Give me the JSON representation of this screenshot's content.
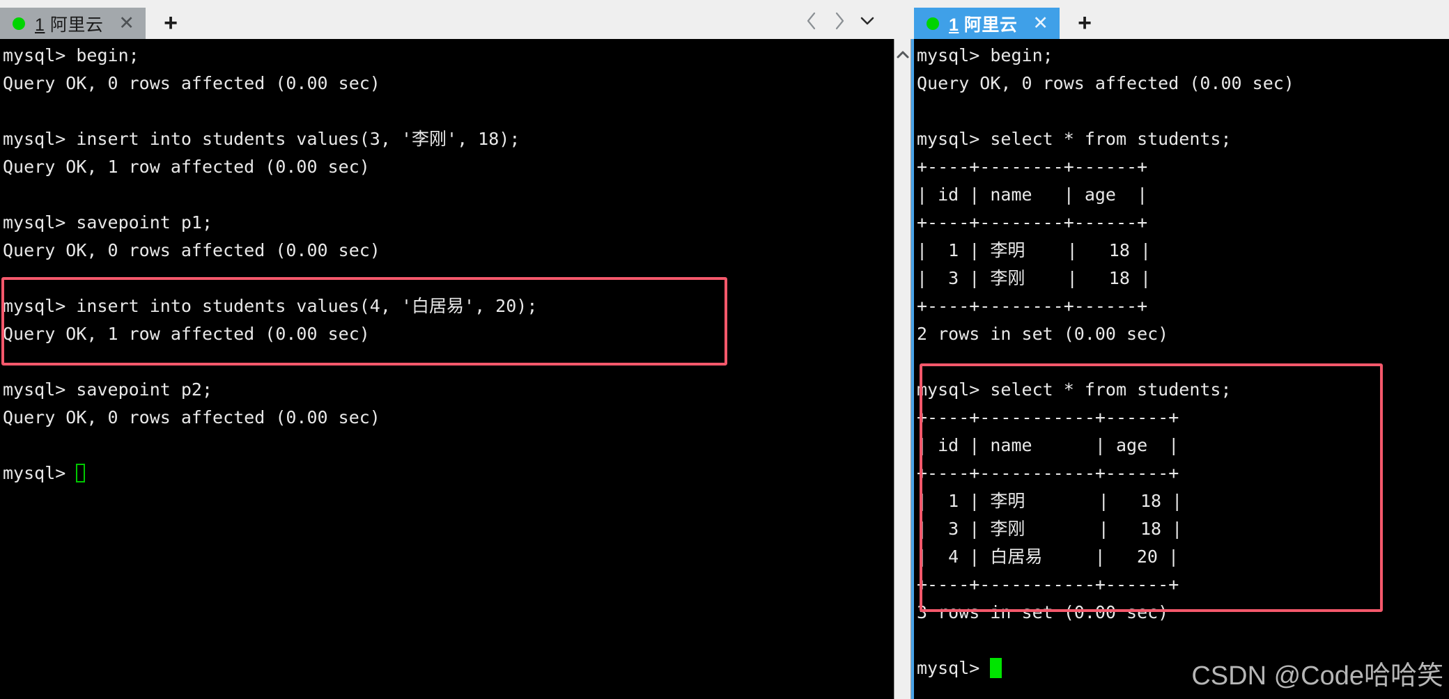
{
  "window": {
    "left_tab": {
      "number": "1",
      "title": "阿里云",
      "close": "✕",
      "add": "+",
      "state": "inactive"
    },
    "right_tab": {
      "number": "1",
      "title": "阿里云",
      "close": "✕",
      "add": "+",
      "state": "active"
    },
    "nav": {
      "prev": "back-chevron",
      "next": "forward-chevron",
      "list": "dropdown-chevron"
    }
  },
  "left_pane": {
    "prompt": "mysql>",
    "lines": [
      "mysql> begin;",
      "Query OK, 0 rows affected (0.00 sec)",
      "",
      "mysql> insert into students values(3, '李刚', 18);",
      "Query OK, 1 row affected (0.00 sec)",
      "",
      "mysql> savepoint p1;",
      "Query OK, 0 rows affected (0.00 sec)",
      "",
      "mysql> insert into students values(4, '白居易', 20);",
      "Query OK, 1 row affected (0.00 sec)",
      "",
      "mysql> savepoint p2;",
      "Query OK, 0 rows affected (0.00 sec)",
      "",
      "mysql> "
    ],
    "cursor": "hollow-green-block",
    "scrollbar": {
      "arrow": "up-chevron"
    }
  },
  "right_pane": {
    "prompt": "mysql>",
    "lines": [
      "mysql> begin;",
      "Query OK, 0 rows affected (0.00 sec)",
      "",
      "mysql> select * from students;",
      "+----+--------+------+",
      "| id | name   | age  |",
      "+----+--------+------+",
      "|  1 | 李明    |   18 |",
      "|  3 | 李刚    |   18 |",
      "+----+--------+------+",
      "2 rows in set (0.00 sec)",
      "",
      "mysql> select * from students;",
      "+----+-----------+------+",
      "| id | name      | age  |",
      "+----+-----------+------+",
      "|  1 | 李明       |   18 |",
      "|  3 | 李刚       |   18 |",
      "|  4 | 白居易     |   20 |",
      "+----+-----------+------+",
      "3 rows in set (0.00 sec)",
      "",
      "mysql> "
    ],
    "cursor": "solid-green-block",
    "tables": [
      {
        "query": "select * from students;",
        "columns": [
          "id",
          "name",
          "age"
        ],
        "rows": [
          [
            "1",
            "李明",
            "18"
          ],
          [
            "3",
            "李刚",
            "18"
          ]
        ],
        "footer": "2 rows in set (0.00 sec)"
      },
      {
        "query": "select * from students;",
        "columns": [
          "id",
          "name",
          "age"
        ],
        "rows": [
          [
            "1",
            "李明",
            "18"
          ],
          [
            "3",
            "李刚",
            "18"
          ],
          [
            "4",
            "白居易",
            "20"
          ]
        ],
        "footer": "3 rows in set (0.00 sec)"
      }
    ]
  },
  "highlights": [
    {
      "id": "left-insert-highlight",
      "color": "#f4586b"
    },
    {
      "id": "right-select-highlight",
      "color": "#f4586b"
    }
  ],
  "watermark": "CSDN @Code哈哈笑",
  "colors": {
    "active_tab": "#3fa0e8",
    "inactive_tab": "#a3a8ac",
    "terminal_bg": "#000000",
    "terminal_fg": "#e8e8e8",
    "cursor_green": "#00e500",
    "highlight_red": "#f4586b",
    "chrome_bg": "#efefef"
  }
}
